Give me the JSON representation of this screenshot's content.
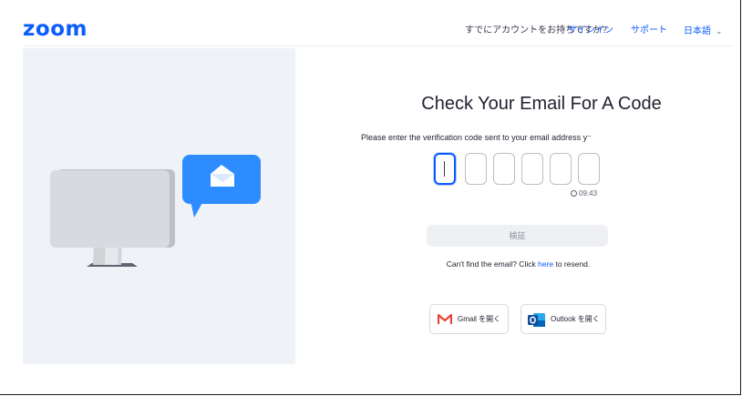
{
  "header": {
    "logo": "zoom",
    "question": "すでにアカウントをお持ちですか?",
    "signin": "サインイン",
    "support": "サポート",
    "language": "日本語"
  },
  "main": {
    "title": "Check Your Email For A Code",
    "instruction": "Please enter the verification code sent to your email address y⁻",
    "code_digits": [
      "",
      "",
      "",
      "",
      "",
      ""
    ],
    "timer": "09:43",
    "verify_label": "検証",
    "resend_prefix": "Can't find the email? Click ",
    "resend_link": "here",
    "resend_suffix": " to resend.",
    "gmail_label": "Gmail を開く",
    "outlook_label": "Outlook を開く"
  },
  "colors": {
    "brand": "#0b5cff",
    "illustration_bg": "#eff3f8",
    "envelope_bubble": "#2d8cff"
  },
  "icons": [
    "envelope-icon",
    "chevron-down-icon",
    "clock-icon",
    "gmail-icon",
    "outlook-icon"
  ]
}
